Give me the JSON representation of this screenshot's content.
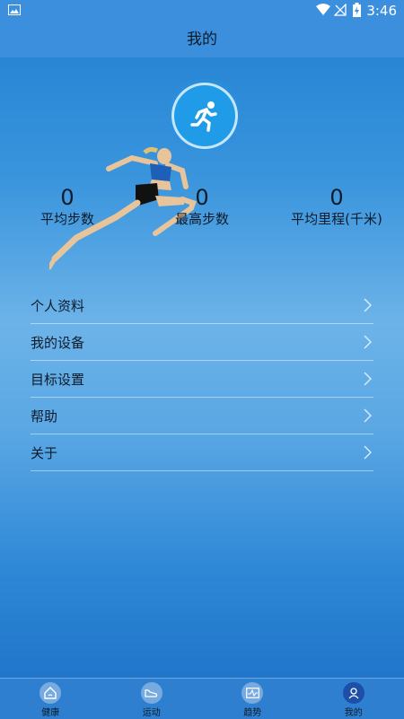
{
  "status_bar": {
    "time": "3:46"
  },
  "header": {
    "title": "我的"
  },
  "stats": [
    {
      "value": "0",
      "label": "平均步数"
    },
    {
      "value": "0",
      "label": "最高步数"
    },
    {
      "value": "0",
      "label": "平均里程(千米)"
    }
  ],
  "menu": [
    {
      "label": "个人资料"
    },
    {
      "label": "我的设备"
    },
    {
      "label": "目标设置"
    },
    {
      "label": "帮助"
    },
    {
      "label": "关于"
    }
  ],
  "bottom_nav": [
    {
      "label": "健康",
      "icon": "home-icon",
      "active": false
    },
    {
      "label": "运动",
      "icon": "shoe-icon",
      "active": false
    },
    {
      "label": "趋势",
      "icon": "chart-icon",
      "active": false
    },
    {
      "label": "我的",
      "icon": "person-icon",
      "active": true
    }
  ],
  "colors": {
    "primary": "#3b8fdc",
    "active_tab": "#1e4fa8"
  }
}
